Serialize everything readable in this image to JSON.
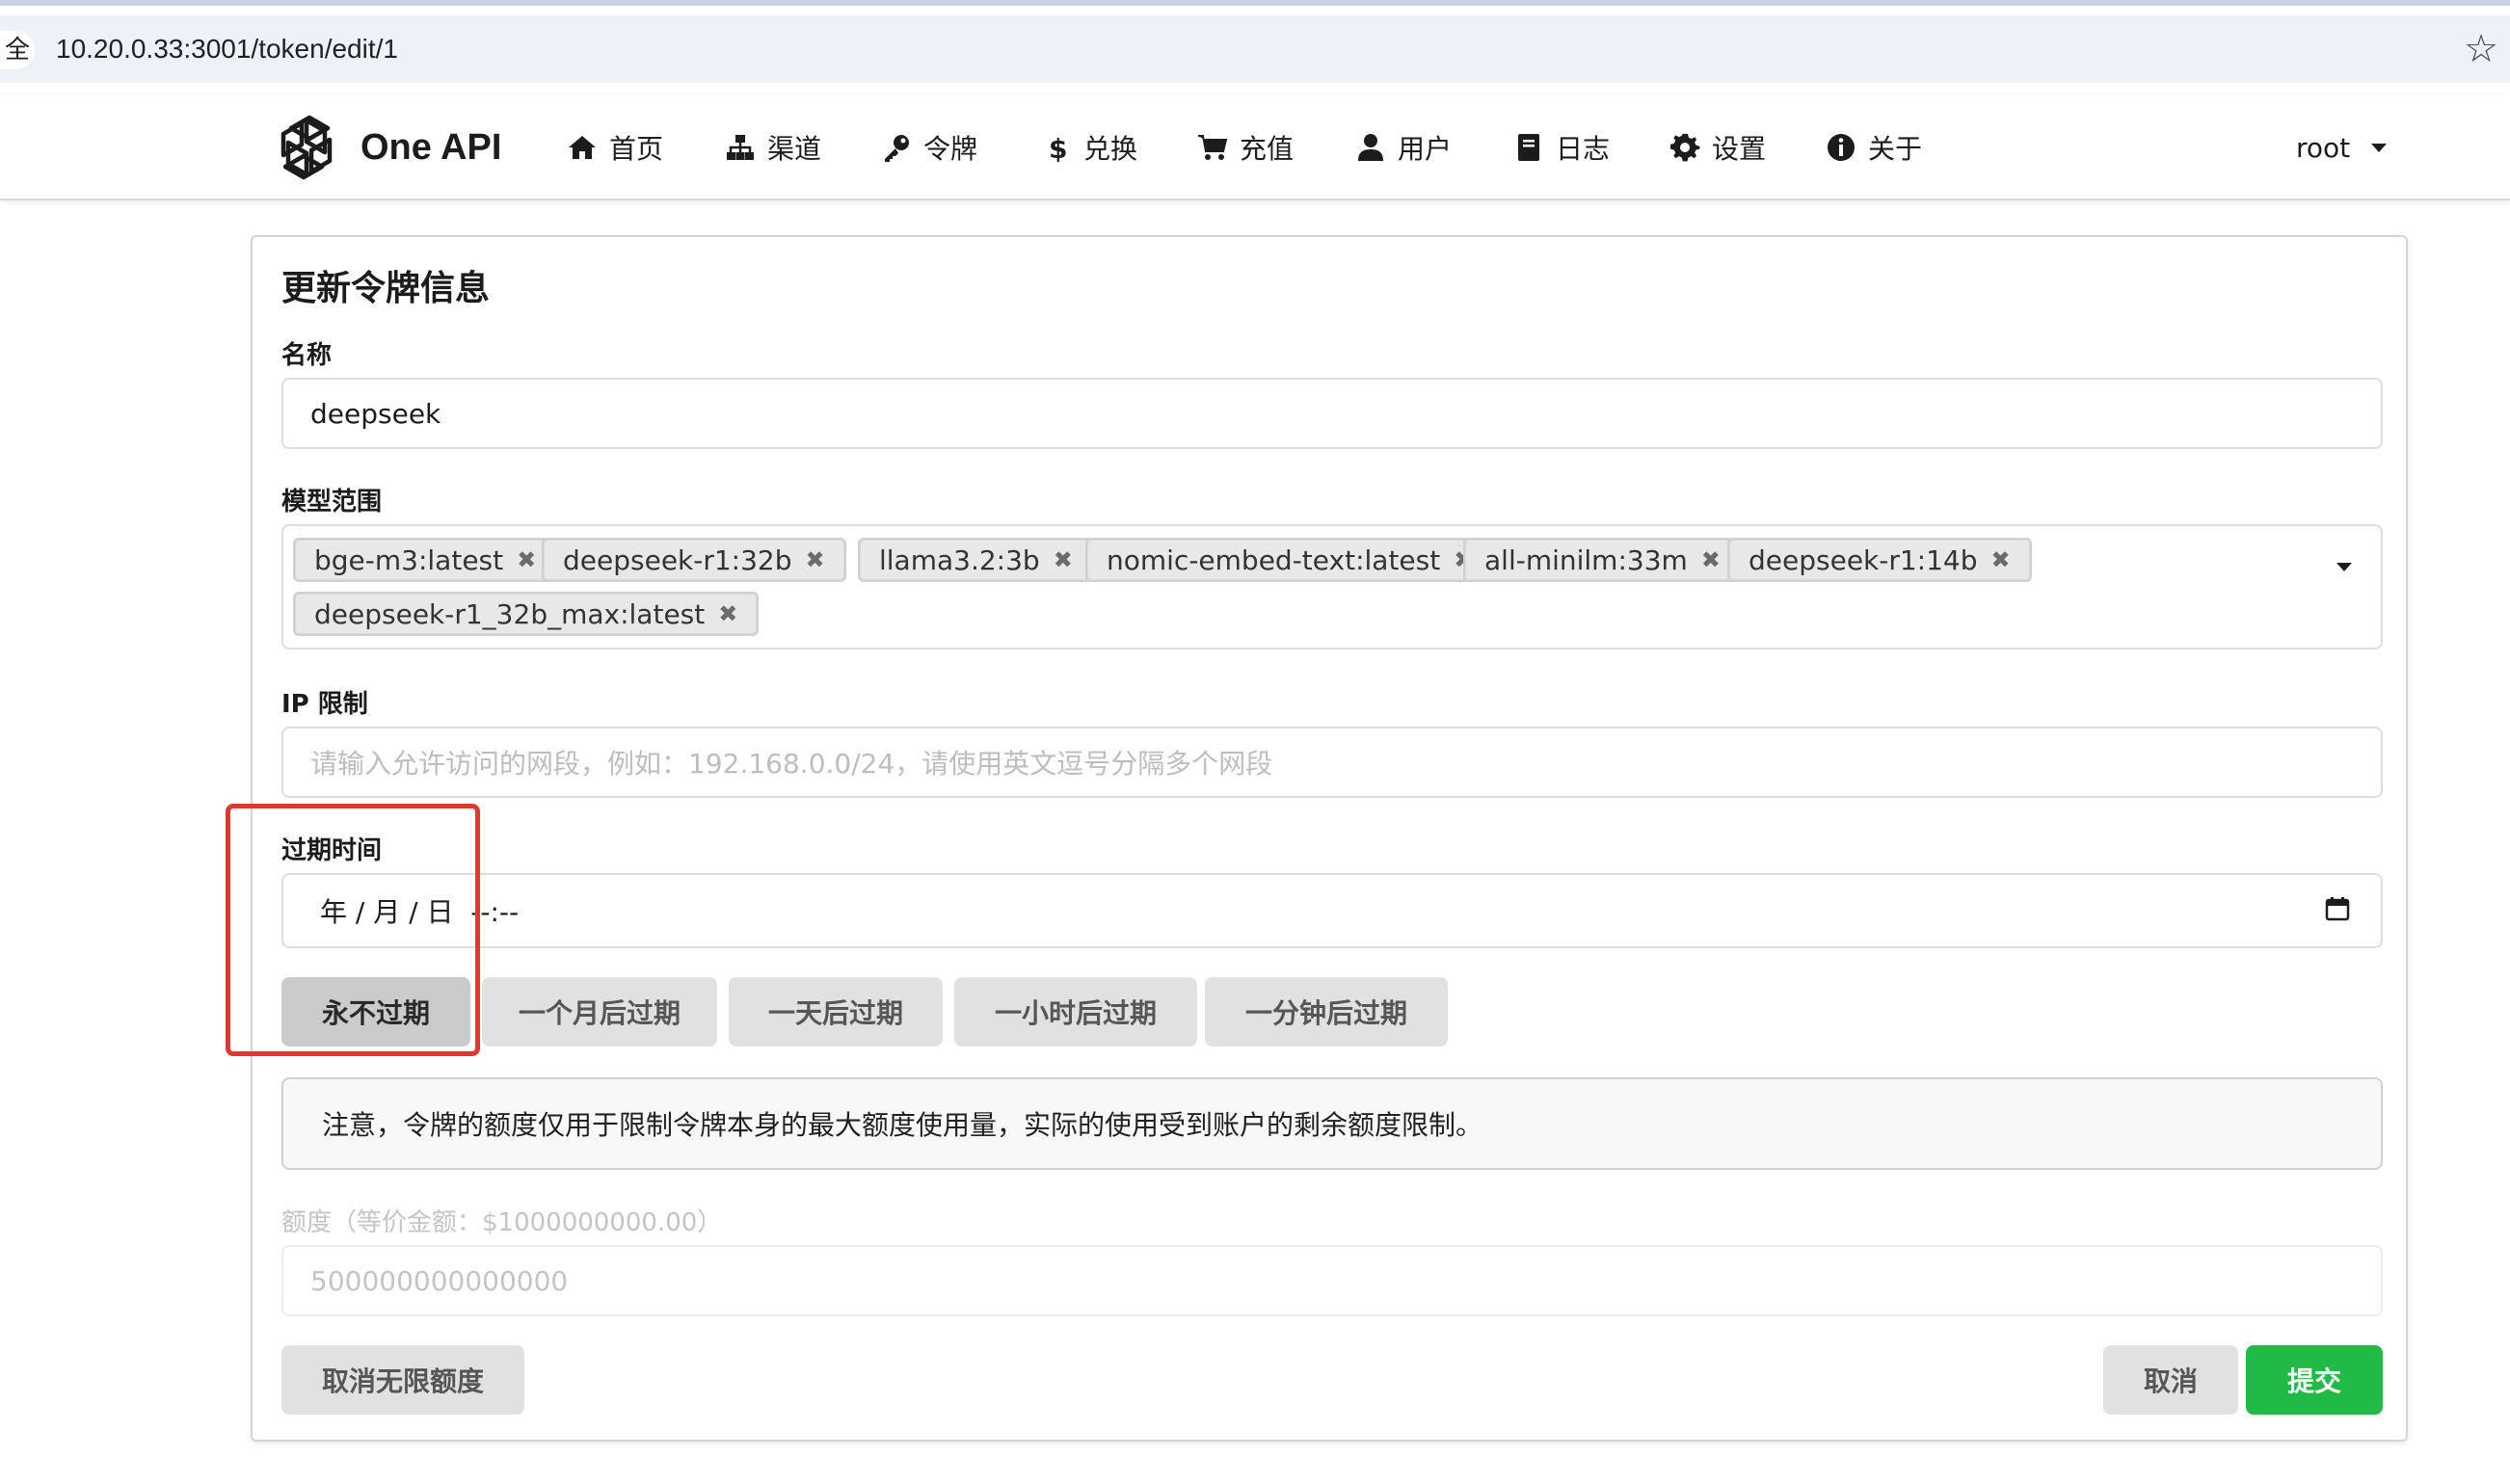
{
  "browser": {
    "left_glyph": "全",
    "url": "10.20.0.33:3001/token/edit/1"
  },
  "header": {
    "brand": "One API",
    "nav": [
      {
        "label": "首页",
        "icon": "home-icon"
      },
      {
        "label": "渠道",
        "icon": "sitemap-icon"
      },
      {
        "label": "令牌",
        "icon": "key-icon"
      },
      {
        "label": "兑换",
        "icon": "dollar-icon"
      },
      {
        "label": "充值",
        "icon": "cart-icon"
      },
      {
        "label": "用户",
        "icon": "user-icon"
      },
      {
        "label": "日志",
        "icon": "book-icon"
      },
      {
        "label": "设置",
        "icon": "gear-icon"
      },
      {
        "label": "关于",
        "icon": "info-icon"
      }
    ],
    "user": "root"
  },
  "form": {
    "title": "更新令牌信息",
    "name_label": "名称",
    "name_value": "deepseek",
    "models_label": "模型范围",
    "models": [
      "bge-m3:latest",
      "deepseek-r1:32b",
      "llama3.2:3b",
      "nomic-embed-text:latest",
      "all-minilm:33m",
      "deepseek-r1:14b",
      "deepseek-r1_32b_max:latest"
    ],
    "ip_label": "IP 限制",
    "ip_placeholder": "请输入允许访问的网段，例如：192.168.0.0/24，请使用英文逗号分隔多个网段",
    "expire_label": "过期时间",
    "expire_value": "年 / 月 / 日  --:--",
    "expire_buttons": [
      "永不过期",
      "一个月后过期",
      "一天后过期",
      "一小时后过期",
      "一分钟后过期"
    ],
    "notice": "注意，令牌的额度仅用于限制令牌本身的最大额度使用量，实际的使用受到账户的剩余额度限制。",
    "quota_label": "额度（等价金额：$1000000000.00）",
    "quota_value": "500000000000000",
    "unlimited_button": "取消无限额度",
    "cancel_button": "取消",
    "submit_button": "提交"
  },
  "colors": {
    "accent_green": "#21ba45",
    "annotation_red": "#e0382e"
  }
}
